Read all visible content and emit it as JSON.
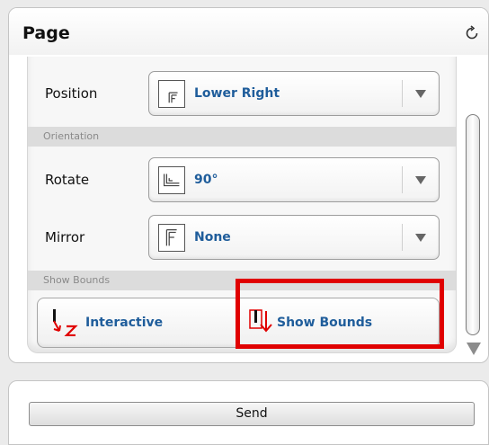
{
  "panel": {
    "title": "Page",
    "refresh_icon": "refresh-icon"
  },
  "position": {
    "label": "Position",
    "value": "Lower Right",
    "icon": "position-lower-right-icon"
  },
  "orientation_section": "Orientation",
  "rotate": {
    "label": "Rotate",
    "value": "90°",
    "icon": "rotate-90-icon"
  },
  "mirror": {
    "label": "Mirror",
    "value": "None",
    "icon": "mirror-none-icon"
  },
  "bounds_section": "Show Bounds",
  "bounds": {
    "interactive_label": "Interactive",
    "interactive_icon": "interactive-icon",
    "show_bounds_label": "Show Bounds",
    "show_bounds_icon": "show-bounds-icon"
  },
  "send": {
    "label": "Send"
  },
  "colors": {
    "accent_text": "#1f5d9b",
    "highlight": "#e00000",
    "icon_red": "#e00000"
  }
}
